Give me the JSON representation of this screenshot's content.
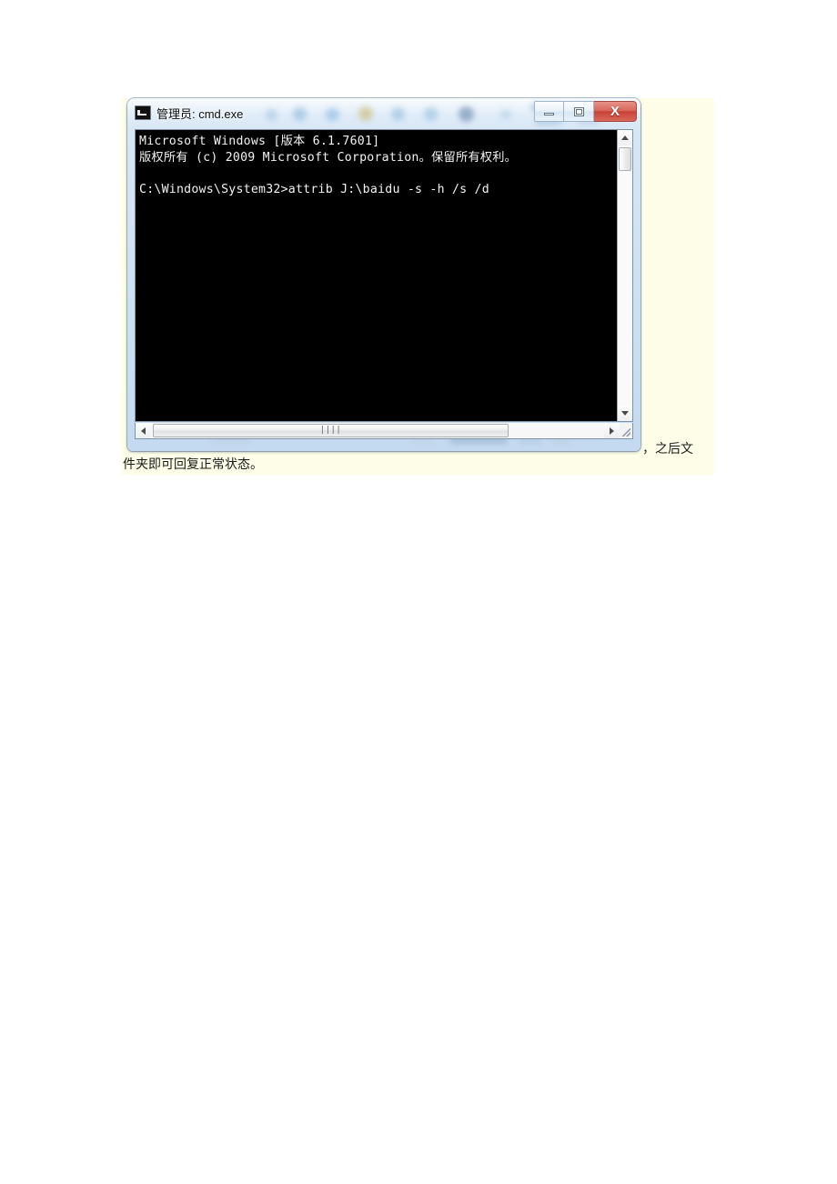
{
  "page": {
    "background": "#ffffff",
    "doc_block_background": "#fefee8"
  },
  "window": {
    "title": "管理员: cmd.exe",
    "icon": "cmd-console-icon",
    "accent_close": "#c84336",
    "frame_color": "#cfe2f4",
    "buttons": {
      "minimize_label": "",
      "maximize_label": "",
      "close_label": "X"
    }
  },
  "console": {
    "background": "#000000",
    "foreground": "#f2f2f2",
    "lines": [
      "Microsoft Windows [版本 6.1.7601]",
      "版权所有 (c) 2009 Microsoft Corporation。保留所有权利。",
      "",
      "C:\\Windows\\System32>attrib J:\\baidu -s -h /s /d"
    ],
    "full_text": "Microsoft Windows [版本 6.1.7601]\n版权所有 (c) 2009 Microsoft Corporation。保留所有权利。\n\nC:\\Windows\\System32>attrib J:\\baidu -s -h /s /d"
  },
  "scrollbars": {
    "vertical": {
      "up_arrow": "triangle-up-icon",
      "down_arrow": "triangle-down-icon"
    },
    "horizontal": {
      "left_arrow": "triangle-left-icon",
      "right_arrow": "triangle-right-icon",
      "grip": "||||"
    },
    "resize_grip": "resize-grip-icon"
  },
  "document": {
    "trailing_text": "，之后文",
    "next_line_text": "件夹即可回复正常状态。"
  }
}
